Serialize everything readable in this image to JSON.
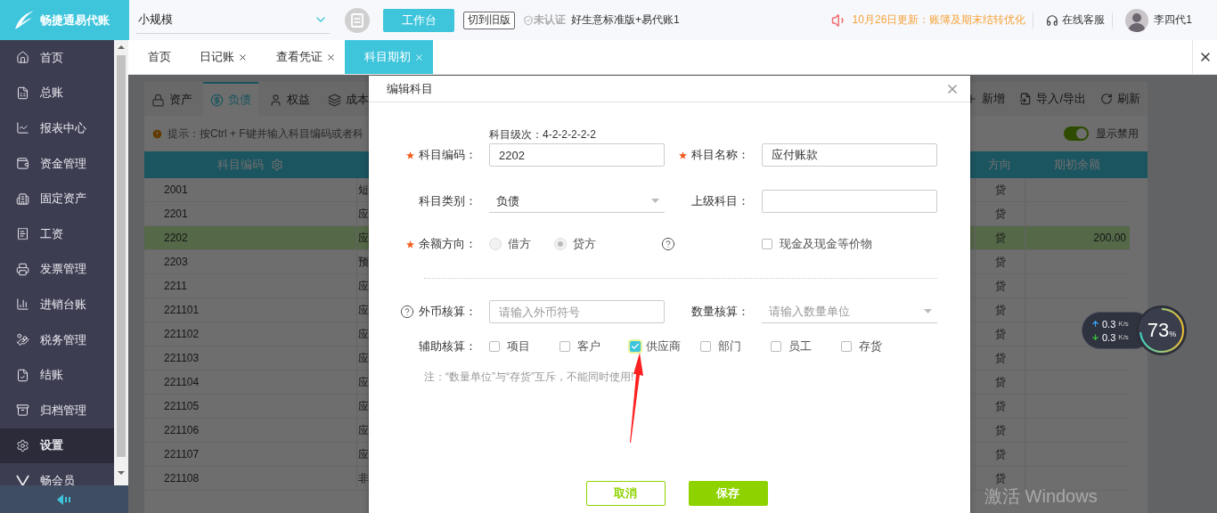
{
  "logo": {
    "text": "畅捷通易代账"
  },
  "top_bar": {
    "taxpayer_select": "小规模",
    "workbench_button": "工作台",
    "old_version_button": "切到旧版",
    "certification": "未认证",
    "product": "好生意标准版+易代账1",
    "update_notice": "10月26日更新：账簿及期末结转优化",
    "support": "在线客服",
    "user": "李四代1"
  },
  "sidebar": {
    "items": [
      {
        "label": "首页",
        "selected": false
      },
      {
        "label": "总账",
        "selected": false
      },
      {
        "label": "报表中心",
        "selected": false
      },
      {
        "label": "资金管理",
        "selected": false
      },
      {
        "label": "固定资产",
        "selected": false
      },
      {
        "label": "工资",
        "selected": false
      },
      {
        "label": "发票管理",
        "selected": false
      },
      {
        "label": "进销台账",
        "selected": false
      },
      {
        "label": "税务管理",
        "selected": false
      },
      {
        "label": "结账",
        "selected": false
      },
      {
        "label": "归档管理",
        "selected": false
      },
      {
        "label": "设置",
        "selected": true
      },
      {
        "label": "畅会员",
        "selected": false
      }
    ]
  },
  "tabs": [
    {
      "label": "首页",
      "closable": false,
      "selected": false
    },
    {
      "label": "日记账",
      "closable": true,
      "selected": false
    },
    {
      "label": "查看凭证",
      "closable": true,
      "selected": false
    },
    {
      "label": "科目期初",
      "closable": true,
      "selected": true
    }
  ],
  "subject_tabs": [
    {
      "label": "资产",
      "selected": false
    },
    {
      "label": "负债",
      "selected": true
    },
    {
      "label": "权益",
      "selected": false
    },
    {
      "label": "成本",
      "selected": false
    }
  ],
  "toolbar": [
    {
      "label": "新增",
      "kind": "add"
    },
    {
      "label": "导入/导出",
      "kind": "import"
    },
    {
      "label": "刷新",
      "kind": "refresh"
    }
  ],
  "hint": "提示：按Ctrl + F键并输入科目编码或者科",
  "show_disabled": {
    "label": "显示禁用",
    "on": true
  },
  "table": {
    "columns": [
      "科目编码",
      "方向",
      "期初余额"
    ],
    "rows": [
      {
        "code": "2001",
        "name": "短",
        "direction": "贷",
        "selected": false
      },
      {
        "code": "2201",
        "name": "应",
        "direction": "贷",
        "selected": false
      },
      {
        "code": "2202",
        "name": "应",
        "direction": "贷",
        "balance": "200.00",
        "selected": true
      },
      {
        "code": "2203",
        "name": "预",
        "direction": "贷",
        "selected": false
      },
      {
        "code": "2211",
        "name": "应",
        "direction": "贷",
        "selected": false
      },
      {
        "code": "221101",
        "name": "应",
        "direction": "贷",
        "selected": false
      },
      {
        "code": "221102",
        "name": "应",
        "direction": "贷",
        "selected": false
      },
      {
        "code": "221103",
        "name": "应",
        "direction": "贷",
        "selected": false
      },
      {
        "code": "221104",
        "name": "应",
        "direction": "贷",
        "selected": false
      },
      {
        "code": "221105",
        "name": "应",
        "direction": "贷",
        "selected": false
      },
      {
        "code": "221106",
        "name": "应",
        "direction": "贷",
        "selected": false
      },
      {
        "code": "221107",
        "name": "应",
        "direction": "贷",
        "selected": false
      },
      {
        "code": "221108",
        "name": "非",
        "direction": "贷",
        "selected": false
      }
    ]
  },
  "dialog": {
    "title": "编辑科目",
    "level_hint": "科目级次：4-2-2-2-2-2",
    "code": {
      "label": "科目编码：",
      "required": true,
      "value": "2202"
    },
    "name": {
      "label": "科目名称：",
      "required": true,
      "value": "应付账款"
    },
    "category": {
      "label": "科目类别：",
      "value": "负债"
    },
    "parent": {
      "label": "上级科目："
    },
    "balance_direction": {
      "label": "余额方向：",
      "required": true,
      "options": [
        {
          "label": "借方",
          "selected": false
        },
        {
          "label": "贷方",
          "selected": true
        }
      ]
    },
    "cash_equivalent": {
      "label": "现金及现金等价物",
      "checked": false
    },
    "currency": {
      "label": "外币核算：",
      "placeholder": "请输入外币符号"
    },
    "quantity": {
      "label": "数量核算：",
      "placeholder": "请输入数量单位"
    },
    "auxiliary": {
      "label": "辅助核算：",
      "options": [
        {
          "label": "项目",
          "checked": false
        },
        {
          "label": "客户",
          "checked": false
        },
        {
          "label": "供应商",
          "checked": true
        },
        {
          "label": "部门",
          "checked": false
        },
        {
          "label": "员工",
          "checked": false
        },
        {
          "label": "存货",
          "checked": false
        }
      ]
    },
    "note": "注：“数量单位”与“存货”互斥，不能同时使用!",
    "buttons": [
      {
        "label": "取消",
        "kind": "secondary"
      },
      {
        "label": "保存",
        "kind": "primary"
      }
    ]
  },
  "network_widget": {
    "upload": "0.3",
    "upload_unit": "K/s",
    "download": "0.3",
    "download_unit": "K/s",
    "usage": "73",
    "usage_unit": "%"
  },
  "os_notice": "激活 Windows"
}
